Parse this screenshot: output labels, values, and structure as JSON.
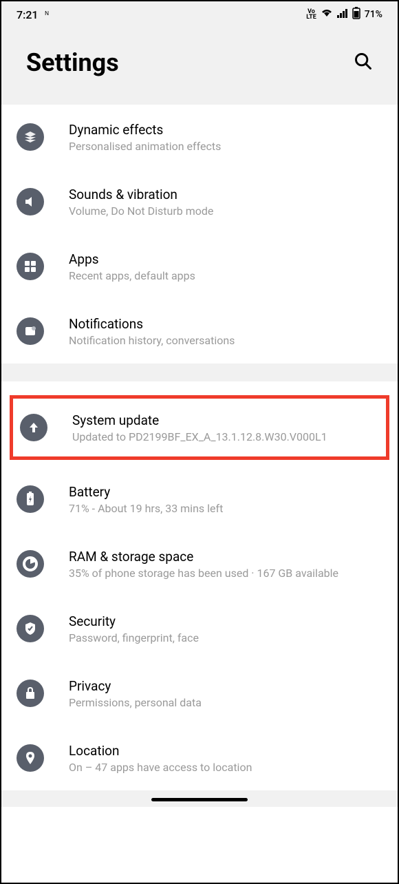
{
  "status": {
    "time": "7:21",
    "volte": "VoLTE",
    "battery_pct": "71%"
  },
  "header": {
    "title": "Settings"
  },
  "items": [
    {
      "title": "Dynamic effects",
      "subtitle": "Personalised animation effects"
    },
    {
      "title": "Sounds & vibration",
      "subtitle": "Volume, Do Not Disturb mode"
    },
    {
      "title": "Apps",
      "subtitle": "Recent apps, default apps"
    },
    {
      "title": "Notifications",
      "subtitle": "Notification history, conversations"
    },
    {
      "title": "System update",
      "subtitle": "Updated to PD2199BF_EX_A_13.1.12.8.W30.V000L1"
    },
    {
      "title": "Battery",
      "subtitle": "71% - About 19 hrs, 33 mins left"
    },
    {
      "title": "RAM & storage space",
      "subtitle": "35% of phone storage has been used · 167 GB available"
    },
    {
      "title": "Security",
      "subtitle": "Password, fingerprint, face"
    },
    {
      "title": "Privacy",
      "subtitle": "Permissions, personal data"
    },
    {
      "title": "Location",
      "subtitle": "On – 47 apps have access to location"
    }
  ]
}
